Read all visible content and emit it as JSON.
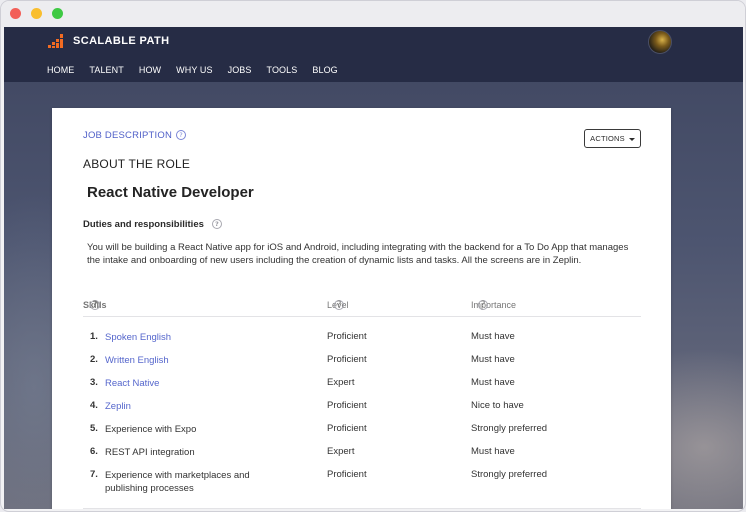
{
  "browser": {
    "controls": [
      "close",
      "minimize",
      "maximize"
    ]
  },
  "header": {
    "logo_text": "SCALABLE PATH",
    "logo_color": "#f26b22",
    "nav": [
      "HOME",
      "TALENT",
      "HOW",
      "WHY US",
      "JOBS",
      "TOOLS",
      "BLOG"
    ]
  },
  "card": {
    "job_description_label": "JOB DESCRIPTION",
    "actions_label": "ACTIONS",
    "about_heading": "ABOUT THE ROLE",
    "role_title": "React Native Developer",
    "duties_heading": "Duties and responsibilities",
    "duties_text": "You will be building a React Native app for iOS and Android, including integrating with the backend for a To Do App that manages the intake and onboarding of new users including the creation of dynamic lists and tasks. All the screens are in Zeplin.",
    "table_headers": {
      "skills": "Skills",
      "level": "Level",
      "importance": "Importance"
    },
    "skills": [
      {
        "num": "1.",
        "name": "Spoken English",
        "level": "Proficient",
        "importance": "Must have",
        "link": true
      },
      {
        "num": "2.",
        "name": "Written English",
        "level": "Proficient",
        "importance": "Must have",
        "link": true
      },
      {
        "num": "3.",
        "name": "React Native",
        "level": "Expert",
        "importance": "Must have",
        "link": true
      },
      {
        "num": "4.",
        "name": "Zeplin",
        "level": "Proficient",
        "importance": "Nice to have",
        "link": true
      },
      {
        "num": "5.",
        "name": "Experience with Expo",
        "level": "Proficient",
        "importance": "Strongly preferred",
        "link": false
      },
      {
        "num": "6.",
        "name": "REST API integration",
        "level": "Expert",
        "importance": "Must have",
        "link": false
      },
      {
        "num": "7.",
        "name": "Experience with marketplaces and publishing processes",
        "level": "Proficient",
        "importance": "Strongly preferred",
        "link": false
      }
    ]
  }
}
